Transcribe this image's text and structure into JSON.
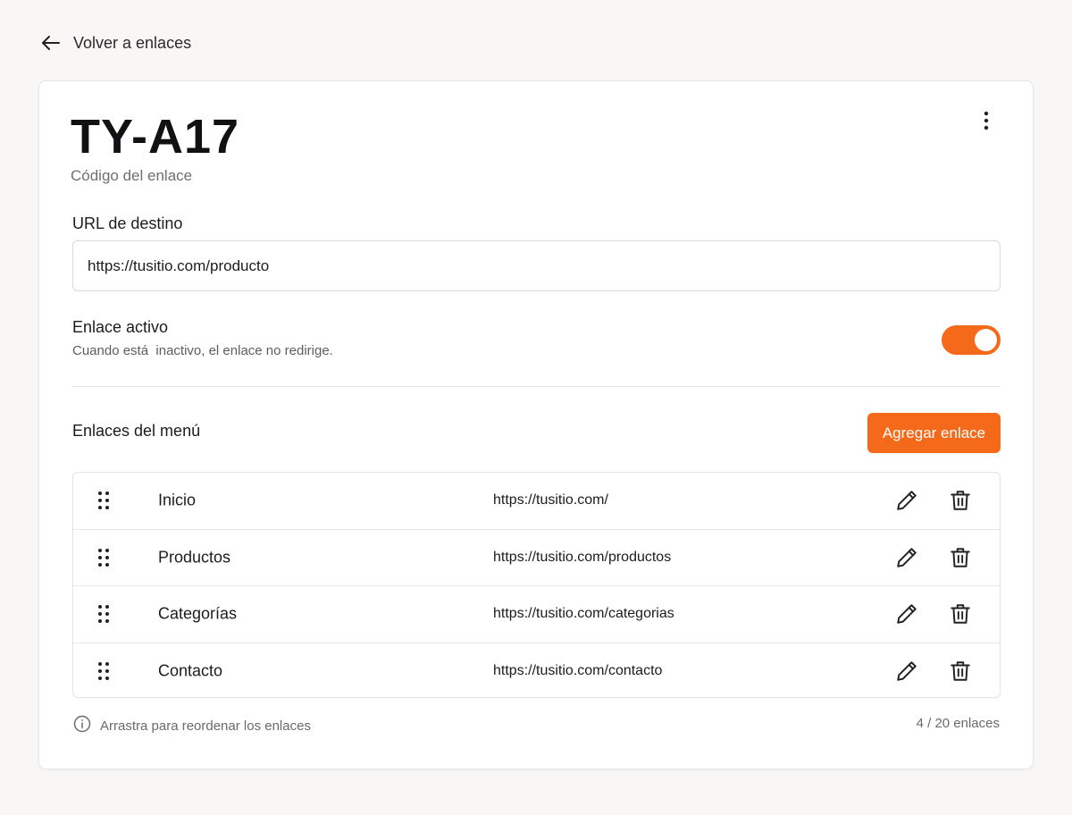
{
  "back_link": {
    "label": "Volver a enlaces",
    "icon": "arrow-left-icon"
  },
  "header": {
    "code": "TY-A17",
    "caption": "Código del enlace",
    "menu_icon": "kebab-menu-icon"
  },
  "destination": {
    "label": "URL de destino",
    "value": "https://tusitio.com/producto"
  },
  "active_toggle": {
    "title": "Enlace activo",
    "description": "Cuando está  inactivo, el enlace no redirige.",
    "on": true
  },
  "menu_links": {
    "title": "Enlaces del menú",
    "add_label": "Agregar enlace",
    "rows": [
      {
        "name": "Inicio",
        "url": "https://tusitio.com/"
      },
      {
        "name": "Productos",
        "url": "https://tusitio.com/productos"
      },
      {
        "name": "Categorías",
        "url": "https://tusitio.com/categorias"
      },
      {
        "name": "Contacto",
        "url": "https://tusitio.com/contacto"
      }
    ],
    "hint": "Arrastra para reordenar los enlaces",
    "count": "4 / 20 enlaces"
  },
  "colors": {
    "accent": "#f56a1a",
    "background": "#f8f7f6",
    "card": "#ffffff"
  }
}
